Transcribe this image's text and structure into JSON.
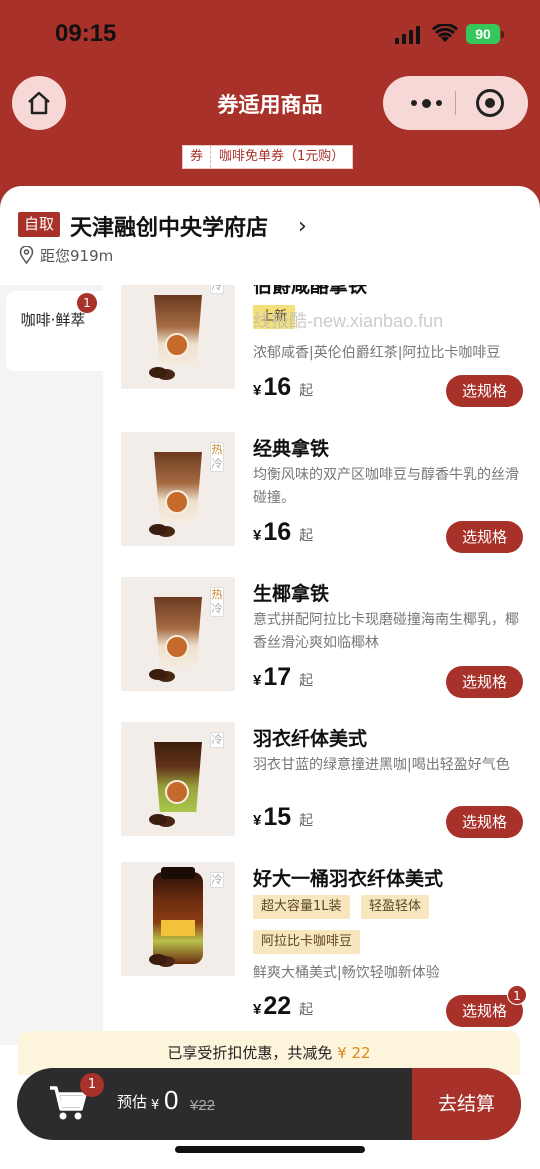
{
  "status": {
    "time": "09:15",
    "battery": "90"
  },
  "header": {
    "title": "券适用商品"
  },
  "coupon": {
    "key": "券",
    "label": "咖啡免单券（1元购）"
  },
  "store": {
    "pickup": "自取",
    "name": "天津融创中央学府店",
    "distance": "距您919m"
  },
  "category": {
    "label": "咖啡·鲜萃",
    "badge": "1"
  },
  "products": [
    {
      "name": "伯爵咸酪拿铁",
      "badge_text": "上新",
      "watermark": "线报酷-new.xianbao.fun",
      "desc": "浓郁咸香|英伦伯爵红茶|阿拉比卡咖啡豆",
      "currency": "¥",
      "price": "16",
      "suffix": "起",
      "button": "选规格",
      "temp": [
        "冷"
      ]
    },
    {
      "name": "经典拿铁",
      "desc": "均衡风味的双产区咖啡豆与醇香牛乳的丝滑碰撞。",
      "currency": "¥",
      "price": "16",
      "suffix": "起",
      "button": "选规格",
      "temp": [
        "热",
        "冷"
      ]
    },
    {
      "name": "生椰拿铁",
      "desc": "意式拼配阿拉比卡现磨碰撞海南生椰乳，椰香丝滑沁爽如临椰林",
      "currency": "¥",
      "price": "17",
      "suffix": "起",
      "button": "选规格",
      "temp": [
        "热",
        "冷"
      ]
    },
    {
      "name": "羽衣纤体美式",
      "desc": "羽衣甘蓝的绿意撞进黑咖|喝出轻盈好气色",
      "currency": "¥",
      "price": "15",
      "suffix": "起",
      "button": "选规格",
      "temp": [
        "冷"
      ]
    },
    {
      "name": "好大一桶羽衣纤体美式",
      "tags": [
        "超大容量1L装",
        "轻盈轻体",
        "阿拉比卡咖啡豆"
      ],
      "desc": "鲜爽大桶美式|畅饮轻咖新体验",
      "currency": "¥",
      "price": "22",
      "suffix": "起",
      "button": "选规格",
      "badge": "1",
      "temp": [
        "冷"
      ]
    }
  ],
  "discount": {
    "text": "已享受折扣优惠，共减免",
    "amount": "¥ 22"
  },
  "cart": {
    "badge": "1",
    "estimate_label": "预估",
    "currency": "¥",
    "estimate": "0",
    "original": "¥22",
    "checkout": "去结算"
  }
}
